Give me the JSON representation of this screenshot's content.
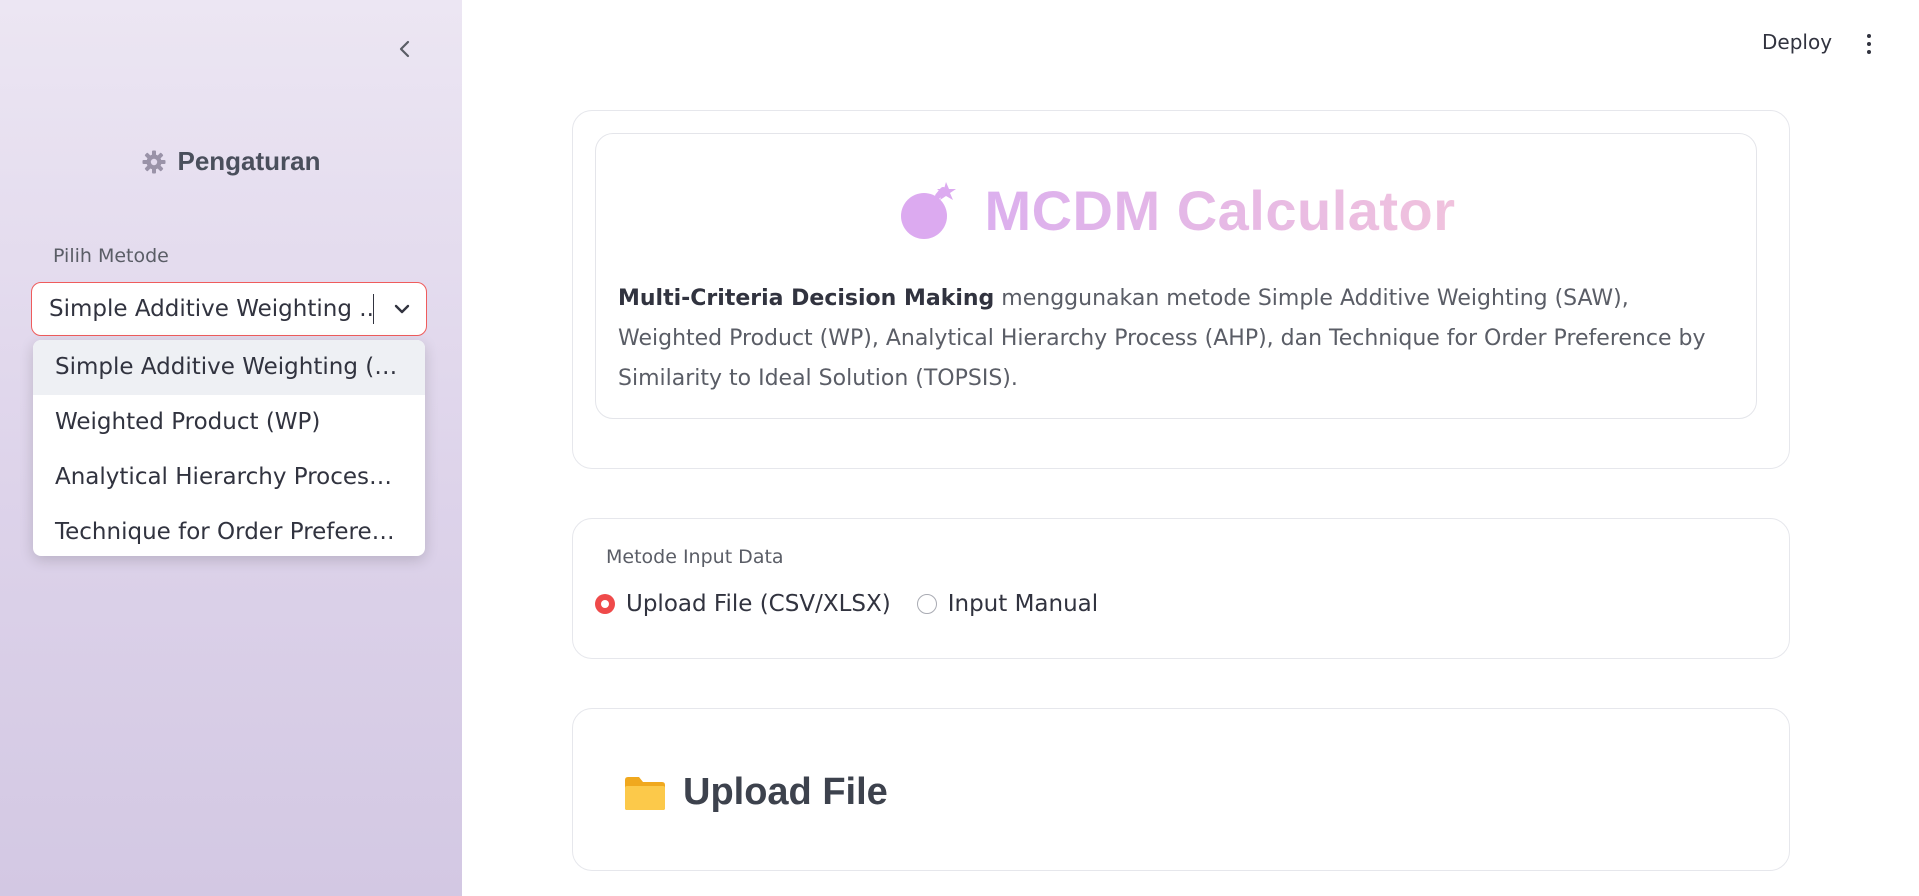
{
  "sidebar": {
    "title": "Pengaturan",
    "method_label": "Pilih Metode",
    "selected_value": "Simple Additive Weighting ...",
    "options": [
      "Simple Additive Weighting (SA…",
      "Weighted Product (WP)",
      "Analytical Hierarchy Process (…",
      "Technique for Order Preferenc…"
    ],
    "selected_index": 0,
    "icons": {
      "collapse": "chevron-left-icon",
      "title": "gear-icon",
      "select": "chevron-down-icon"
    }
  },
  "header": {
    "deploy_label": "Deploy",
    "menu_icon": "vertical-dots-icon"
  },
  "hero": {
    "title": "MCDM Calculator",
    "icon": "bomb-icon",
    "desc_bold": "Multi-Criteria Decision Making",
    "desc_rest": " menggunakan metode Simple Additive Weighting (SAW), Weighted Product (WP), Analytical Hierarchy Process (AHP), dan Technique for Order Preference by Similarity to Ideal Solution (TOPSIS)."
  },
  "input_method": {
    "label": "Metode Input Data",
    "options": [
      "Upload File (CSV/XLSX)",
      "Input Manual"
    ],
    "selected_index": 0
  },
  "upload": {
    "title": "Upload File",
    "icon": "folder-icon"
  },
  "colors": {
    "accent": "#ef4a4a",
    "hero_gradient_start": "#dcb0ee",
    "hero_gradient_end": "#f0c2dd",
    "sidebar_bg": "#e3dbee"
  }
}
